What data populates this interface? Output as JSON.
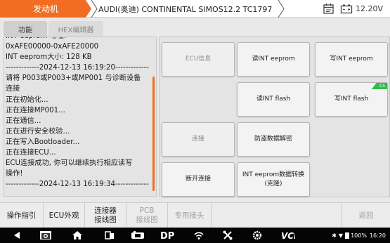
{
  "header": {
    "module": "发动机",
    "vehicle": "AUDI(奥迪) CONTINENTAL SIMOS12.2 TC1797",
    "voltage": "12.20V"
  },
  "tabs": [
    {
      "label": "功能"
    },
    {
      "label": "HEX编辑器"
    }
  ],
  "log": {
    "lines": [
      "INT eeprom 地址:",
      "0xAFE00000-0xAFE20000",
      "INT eeprom大小: 128 KB",
      "-------------2024-12-13 16:19:20-------------",
      "请将 P003或P003+或MP001 与诊断设备",
      "连接",
      "正在初始化...",
      "正在连接MP001...",
      "正在通信...",
      "正在进行安全校验...",
      "正在写入Bootloader...",
      "正在连接ECU...",
      "ECU连接成功, 你可以继续执行相应读写",
      "操作!",
      "-------------2024-12-13 16:19:34-------------"
    ]
  },
  "buttons": {
    "ecu_info": "ECU信息",
    "read_int_eeprom": "读INT eeprom",
    "write_int_eeprom": "写INT eeprom",
    "read_int_flash": "读INT flash",
    "write_int_flash": "写INT flash",
    "write_int_flash_badge": "CS",
    "connect": "连接",
    "immo_decrypt": "防盗数据解密",
    "disconnect": "断开连接",
    "int_eeprom_convert": "INT eeprom数据转换\n(克隆)"
  },
  "bottombar": {
    "guide": "操作指引",
    "ecu_view": "ECU外观",
    "connector_diagram": "连接器\n接线图",
    "pcb_diagram": "PCB\n接线图",
    "special_connector": "专用接头",
    "back": "返回"
  },
  "statusbar": {
    "battery": "100%",
    "time": "16:20"
  },
  "colors": {
    "accent": "#f26d21",
    "badge": "#2ebd4a"
  }
}
